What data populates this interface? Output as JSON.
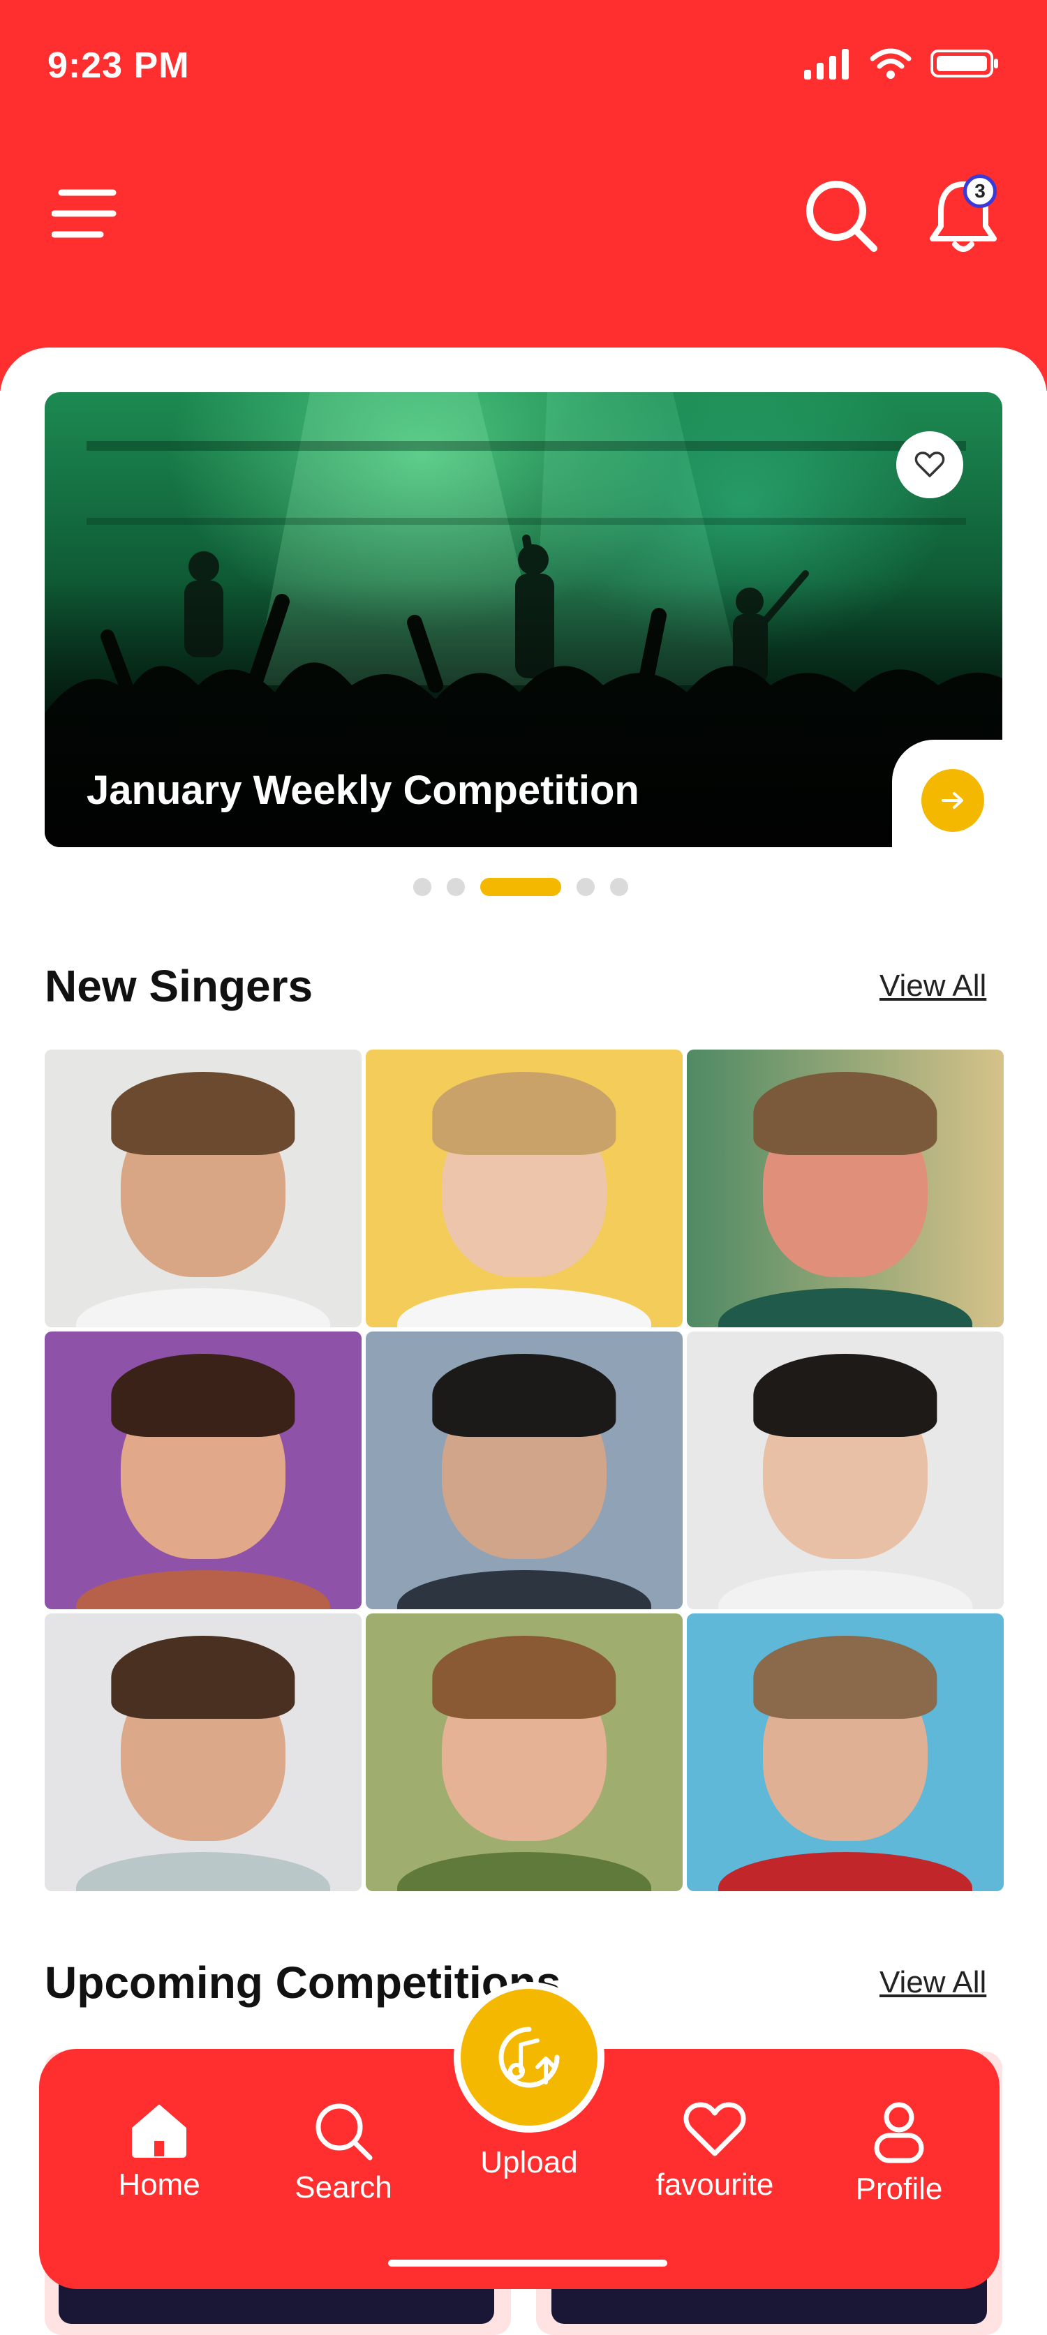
{
  "status_bar": {
    "time": "9:23 PM"
  },
  "header": {
    "notification_count": "3",
    "menu_icon": "hamburger-menu-icon",
    "search_icon": "search-icon",
    "bell_icon": "bell-icon"
  },
  "hero": {
    "title": "January Weekly Competition",
    "heart_icon": "heart-outline-icon",
    "arrow_icon": "arrow-right-icon",
    "carousel_index": 3,
    "carousel_count": 5
  },
  "new_singers": {
    "title": "New Singers",
    "view_all": "View All"
  },
  "upcoming": {
    "title": "Upcoming Competitions",
    "view_all": "View All"
  },
  "nav": {
    "home": "Home",
    "search": "Search",
    "upload": "Upload",
    "favourite": "favourite",
    "profile": "Profile"
  },
  "colors": {
    "primary_red": "#ff2f2f",
    "accent_yellow": "#f5b800",
    "badge_border": "#3a3ad8"
  }
}
